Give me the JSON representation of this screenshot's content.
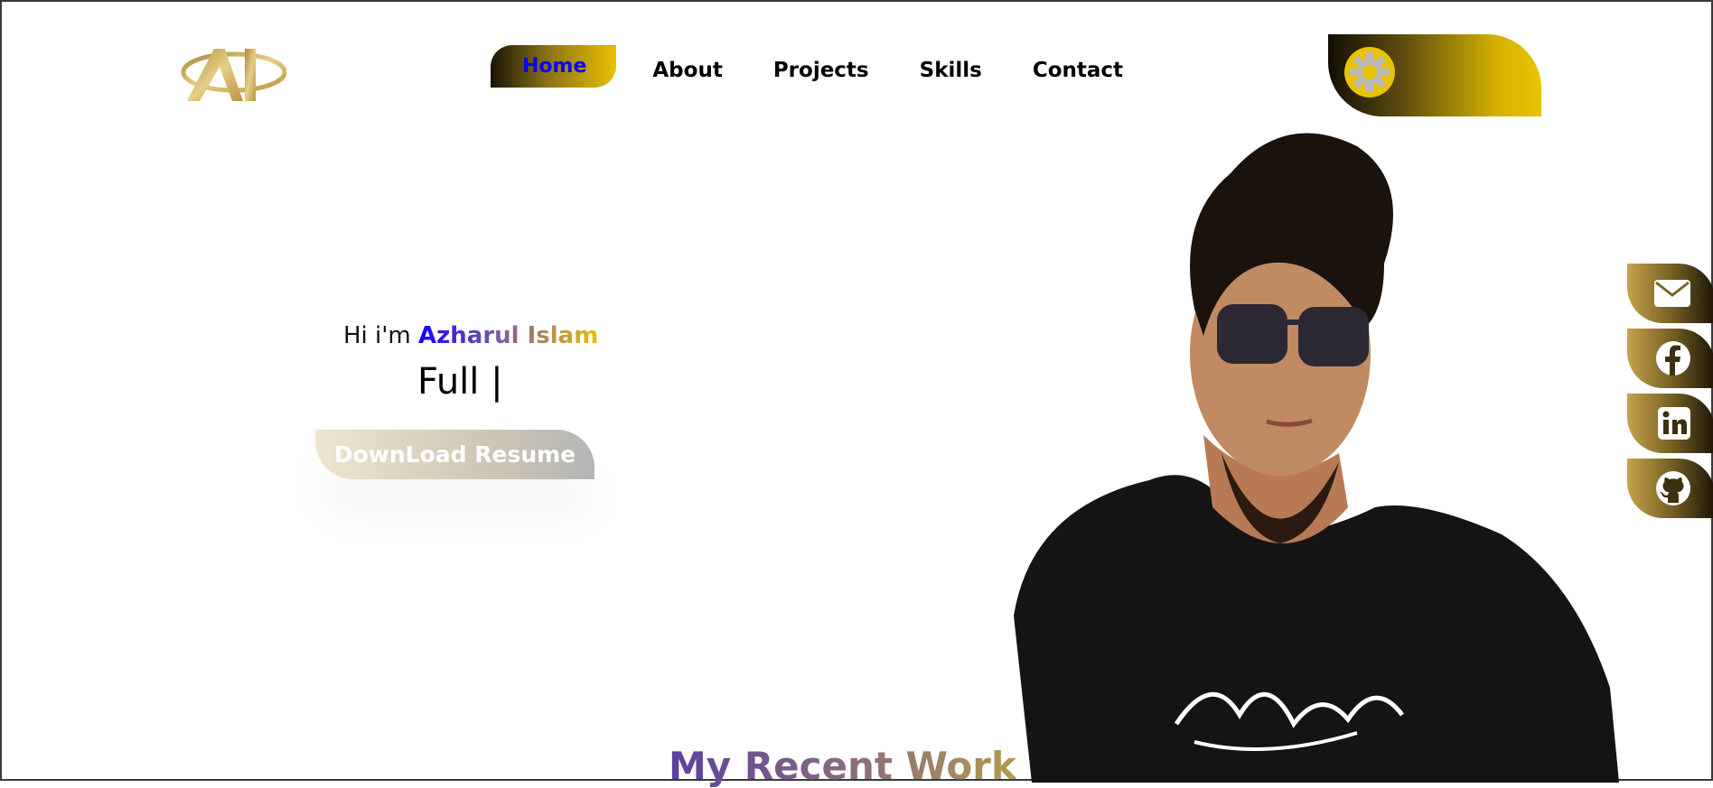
{
  "nav": {
    "items": [
      {
        "label": "Home",
        "active": true
      },
      {
        "label": "About",
        "active": false
      },
      {
        "label": "Projects",
        "active": false
      },
      {
        "label": "Skills",
        "active": false
      },
      {
        "label": "Contact",
        "active": false
      }
    ]
  },
  "hero": {
    "greeting_prefix": "Hi i'm ",
    "name": "Azharul Islam",
    "role_typed": "Full |",
    "resume_button": "DownLoad Resume"
  },
  "theme_toggle": {
    "icon": "gear-icon"
  },
  "social": [
    {
      "name": "email",
      "icon": "envelope-icon"
    },
    {
      "name": "facebook",
      "icon": "facebook-icon"
    },
    {
      "name": "linkedin",
      "icon": "linkedin-icon"
    },
    {
      "name": "github",
      "icon": "github-icon"
    }
  ],
  "sections": {
    "recent_work_title": "My Recent Work"
  },
  "colors": {
    "gold": "#e8c100",
    "dark_gold": "#1a1407",
    "nav_active_text": "#0a00ff",
    "name_start": "#1500ff"
  }
}
